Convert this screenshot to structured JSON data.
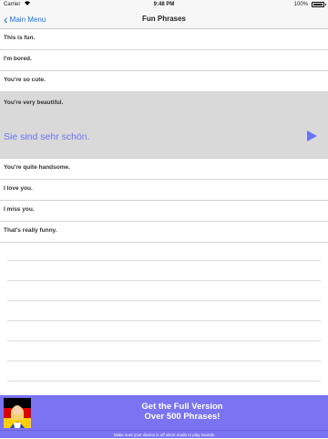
{
  "status_bar": {
    "carrier": "Carrier",
    "time": "9:48 PM",
    "battery_percent": "100%"
  },
  "nav": {
    "back_label": "Main Menu",
    "title": "Fun Phrases"
  },
  "phrases": [
    {
      "text": "This is fun."
    },
    {
      "text": "I'm bored."
    },
    {
      "text": "You're so cute."
    },
    {
      "text": "You're very beautiful.",
      "translation": "Sie sind sehr schön."
    },
    {
      "text": "You're quite handsome."
    },
    {
      "text": "I love you."
    },
    {
      "text": "I miss you."
    },
    {
      "text": "That's really funny."
    }
  ],
  "promo": {
    "line1": "Get the Full Version",
    "line2": "Over 500 Phrases!",
    "footer": "Make sure your device is off silent mode to play sounds"
  },
  "colors": {
    "accent_blue": "#1a73e8",
    "translation_purple": "#6b74f4",
    "promo_background": "#7a74f2",
    "selected_row": "#d9d9d9"
  },
  "icons": {
    "back": "chevron-left-icon",
    "play": "play-icon",
    "wifi": "wifi-icon",
    "battery": "battery-icon"
  }
}
